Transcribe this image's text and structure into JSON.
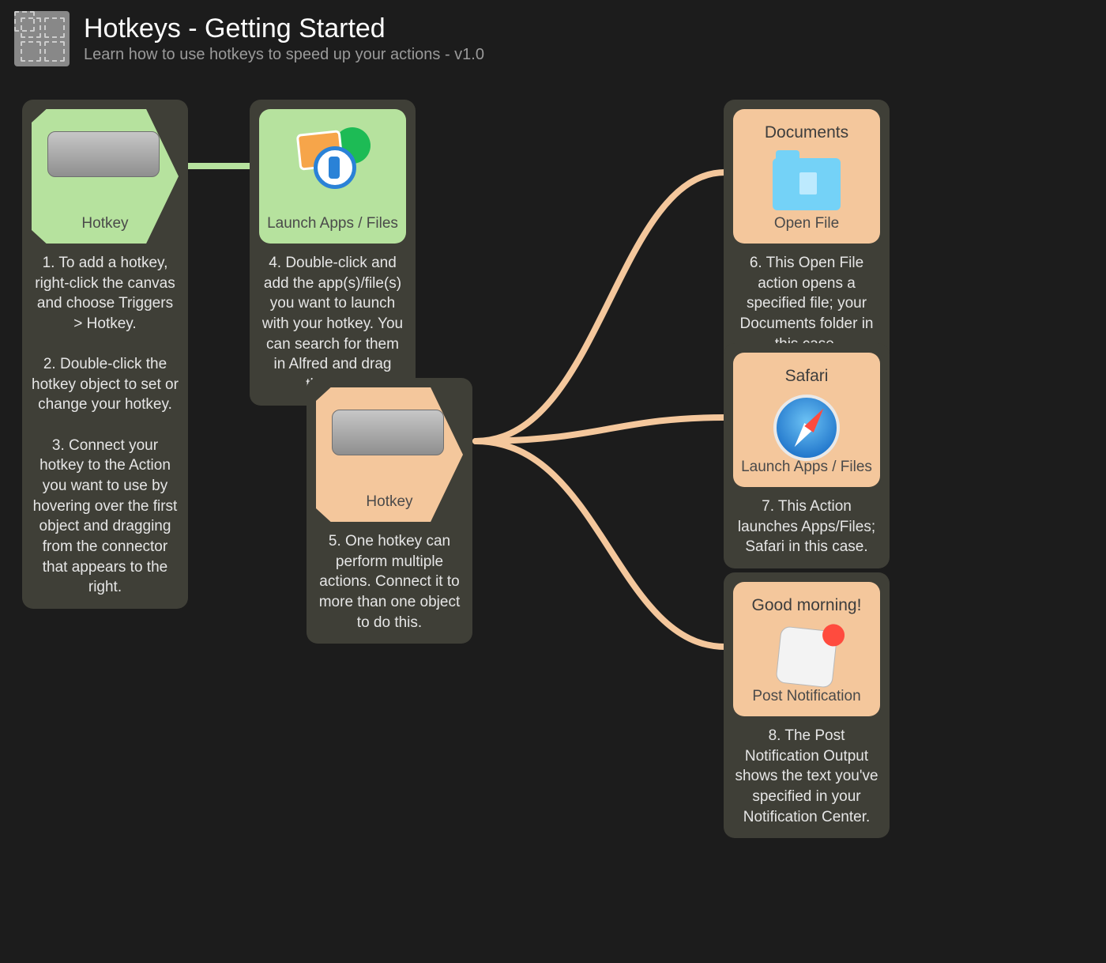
{
  "header": {
    "title": "Hotkeys - Getting Started",
    "subtitle": "Learn how to use hotkeys to speed up your actions - v1.0"
  },
  "nodes": {
    "hotkey1": {
      "label": "Hotkey",
      "note": "1. To add a hotkey, right-click the canvas and choose Triggers > Hotkey.\n\n2. Double-click the hotkey object to set or change your hotkey.\n\n3. Connect your hotkey to the Action you want to use by hovering over the first object and dragging from the connector that appears to the right."
    },
    "launch1": {
      "label": "Launch Apps / Files",
      "note": "4. Double-click and add the app(s)/file(s) you want to launch with your hotkey. You can search for them in Alfred and drag them in."
    },
    "hotkey2": {
      "label": "Hotkey",
      "note": "5. One hotkey can perform multiple actions. Connect it to more than one object to do this."
    },
    "openfile": {
      "title": "Documents",
      "label": "Open File",
      "note": "6. This Open File action opens a specified file; your Documents folder in this case."
    },
    "launch2": {
      "title": "Safari",
      "label": "Launch Apps / Files",
      "note": "7. This Action launches Apps/Files; Safari in this case."
    },
    "notif": {
      "title": "Good morning!",
      "label": "Post Notification",
      "note": "8. The Post Notification Output shows the text you've specified in your Notification Center."
    }
  }
}
